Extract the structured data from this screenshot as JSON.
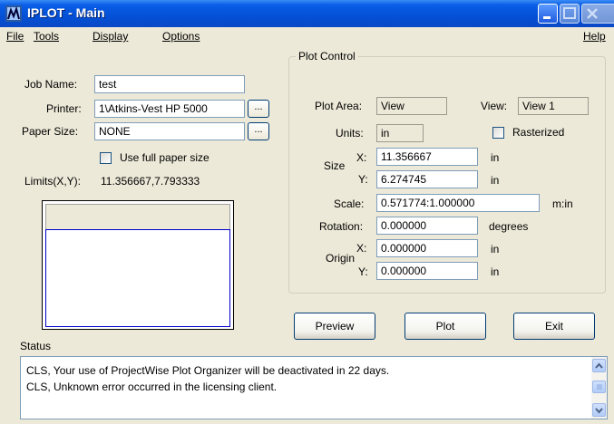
{
  "window": {
    "title": "IPLOT - Main"
  },
  "menu": {
    "file": "File",
    "tools": "Tools",
    "display": "Display",
    "options": "Options",
    "help": "Help"
  },
  "job": {
    "label": "Job Name:",
    "value": "test"
  },
  "printer": {
    "label": "Printer:",
    "value": "1\\Atkins-Vest HP 5000",
    "browse": "..."
  },
  "paper": {
    "label": "Paper Size:",
    "value": "NONE",
    "browse": "..."
  },
  "full_paper": {
    "label": "Use full paper size",
    "checked": false
  },
  "limits": {
    "label": "Limits(X,Y):",
    "value": "11.356667,7.793333"
  },
  "plot_control": {
    "title": "Plot Control",
    "area_label": "Plot Area:",
    "area_value": "View",
    "view_label": "View:",
    "view_value": "View 1",
    "units_label": "Units:",
    "units_value": "in",
    "rasterized_label": "Rasterized",
    "rasterized_checked": false,
    "size_label": "Size",
    "x_label": "X:",
    "y_label": "Y:",
    "size_x": "11.356667",
    "size_y": "6.274745",
    "size_unit": "in",
    "scale_label": "Scale:",
    "scale_value": "0.571774:1.000000",
    "scale_unit": "m:in",
    "rotation_label": "Rotation:",
    "rotation_value": "0.000000",
    "rotation_unit": "degrees",
    "origin_label": "Origin",
    "origin_x": "0.000000",
    "origin_y": "0.000000",
    "origin_unit": "in"
  },
  "buttons": {
    "preview": "Preview",
    "plot": "Plot",
    "exit": "Exit"
  },
  "status": {
    "label": "Status",
    "lines": [
      "CLS, Your use of ProjectWise Plot Organizer will be deactivated in 22 days.",
      "CLS, Unknown error occurred in the licensing client."
    ]
  }
}
